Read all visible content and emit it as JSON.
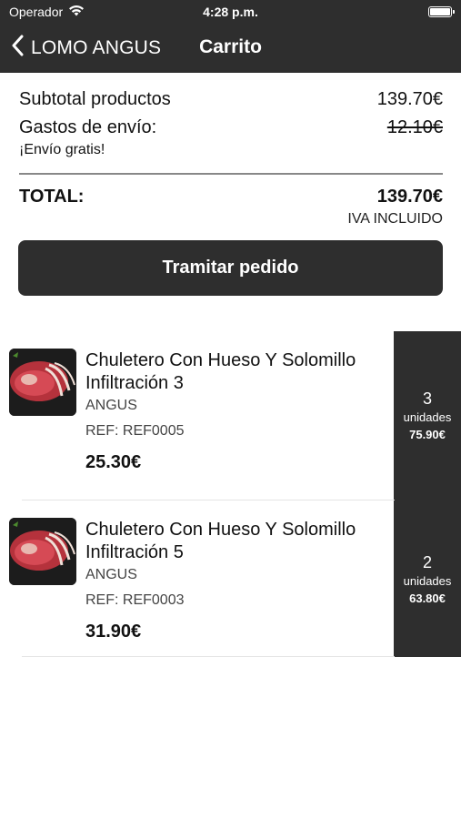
{
  "status_bar": {
    "carrier": "Operador",
    "time": "4:28 p.m."
  },
  "nav": {
    "back_label": "LOMO ANGUS",
    "title": "Carrito"
  },
  "summary": {
    "subtotal_label": "Subtotal productos",
    "subtotal_value": "139.70€",
    "shipping_label": "Gastos de envío:",
    "shipping_value": "12.10€",
    "free_shipping": "¡Envío gratis!",
    "total_label": "TOTAL:",
    "total_value": "139.70€",
    "vat_note": "IVA INCLUIDO"
  },
  "checkout_button": "Tramitar pedido",
  "items": [
    {
      "name": "Chuletero Con Hueso Y Solomillo Infiltración 3",
      "brand": "ANGUS",
      "ref": "REF: REF0005",
      "price": "25.30€",
      "qty": "3",
      "qty_unit": "unidades",
      "line_total": "75.90€"
    },
    {
      "name": "Chuletero Con Hueso Y Solomillo Infiltración 5",
      "brand": "ANGUS",
      "ref": "REF: REF0003",
      "price": "31.90€",
      "qty": "2",
      "qty_unit": "unidades",
      "line_total": "63.80€"
    }
  ],
  "icons": {
    "wifi": "wifi-icon",
    "battery": "battery-icon",
    "back": "chevron-left-icon",
    "product_image": "meat-product-image"
  },
  "colors": {
    "dark": "#2e2e2e",
    "background": "#ffffff",
    "divider": "#888888"
  }
}
